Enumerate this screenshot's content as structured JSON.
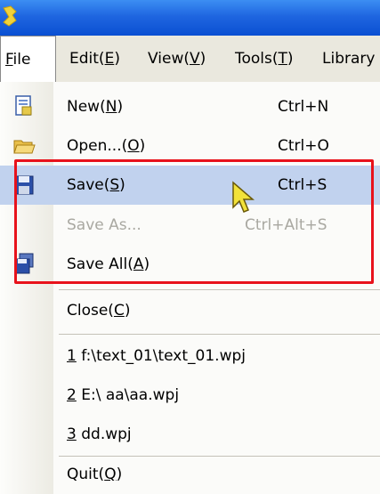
{
  "menubar": {
    "items": [
      {
        "pre": "",
        "key": "F",
        "post": "ile"
      },
      {
        "pre": "Edit(",
        "key": "E",
        "post": ")"
      },
      {
        "pre": "View(",
        "key": "V",
        "post": ")"
      },
      {
        "pre": "Tools(",
        "key": "T",
        "post": ")"
      },
      {
        "pre": "Library",
        "key": "",
        "post": ""
      }
    ]
  },
  "file_menu": {
    "new": {
      "pre": "New(",
      "key": "N",
      "post": ")",
      "shortcut": "Ctrl+N",
      "icon": "new-file-icon"
    },
    "open": {
      "pre": "Open...(",
      "key": "O",
      "post": ")",
      "shortcut": "Ctrl+O",
      "icon": "open-folder-icon"
    },
    "save": {
      "pre": "Save(",
      "key": "S",
      "post": ")",
      "shortcut": "Ctrl+S",
      "icon": "floppy-disk-icon"
    },
    "save_as": {
      "label": "Save As...",
      "shortcut": "Ctrl+Alt+S"
    },
    "save_all": {
      "pre": "Save All(",
      "key": "A",
      "post": ")",
      "icon": "save-all-icon"
    },
    "close": {
      "pre": "Close(",
      "key": "C",
      "post": ")"
    },
    "recent": [
      {
        "key": "1",
        "path": " f:\\text_01\\text_01.wpj"
      },
      {
        "key": "2",
        "path": " E:\\ aa\\aa.wpj"
      },
      {
        "key": "3",
        "path": " dd.wpj"
      }
    ],
    "quit": {
      "pre": "Quit(",
      "key": "Q",
      "post": ")"
    }
  },
  "colors": {
    "titlebar": "#0a4fd2",
    "highlight": "#c1d2ee",
    "annotation_box": "#e8121b",
    "disabled_text": "#a9a8a1"
  }
}
